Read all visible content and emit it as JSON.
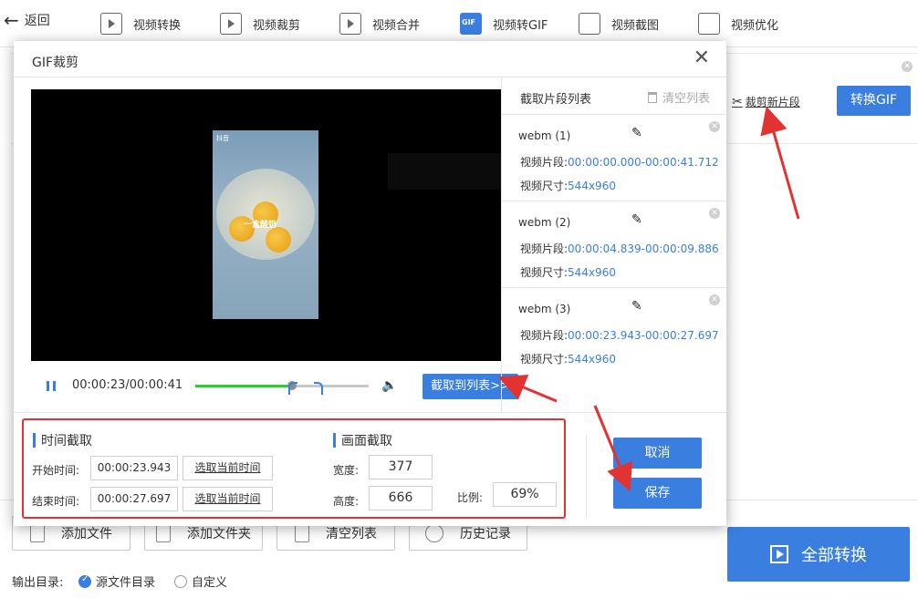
{
  "toolbar": {
    "back_label": "返回",
    "nav": [
      {
        "label": "视频转换",
        "icon": "video-convert-icon"
      },
      {
        "label": "视频裁剪",
        "icon": "video-crop-icon"
      },
      {
        "label": "视频合并",
        "icon": "video-merge-icon"
      },
      {
        "label": "视频转GIF",
        "icon": "gif-icon",
        "active": true
      },
      {
        "label": "视频截图",
        "icon": "screenshot-icon"
      },
      {
        "label": "视频优化",
        "icon": "optimize-icon"
      }
    ]
  },
  "background": {
    "cut_new_segment": "裁剪新片段",
    "convert_gif": "转换GIF",
    "bottom_buttons": [
      {
        "label": "添加文件",
        "icon": "add-file-icon"
      },
      {
        "label": "添加文件夹",
        "icon": "add-folder-icon"
      },
      {
        "label": "清空列表",
        "icon": "clear-list-icon"
      },
      {
        "label": "历史记录",
        "icon": "history-icon"
      }
    ],
    "output_dir_label": "输出目录:",
    "output_options": [
      {
        "label": "源文件目录",
        "selected": true
      },
      {
        "label": "自定义",
        "selected": false
      }
    ],
    "convert_all": "全部转换"
  },
  "dialog": {
    "title": "GIF裁剪",
    "video": {
      "caption": "一盒酸奶",
      "watermark": "抖音"
    },
    "player": {
      "time": "00:00:23/00:00:41",
      "progress": 0.56,
      "grab_button": "截取到列表>>"
    },
    "segments": {
      "header": "截取片段列表",
      "clear_label": "清空列表",
      "segment_label": "视频片段:",
      "size_label": "视频尺寸:",
      "items": [
        {
          "name": "webm (1)",
          "range": "00:00:00.000-00:00:41.712",
          "size": "544x960"
        },
        {
          "name": "webm (2)",
          "range": "00:00:04.839-00:00:09.886",
          "size": "544x960"
        },
        {
          "name": "webm (3)",
          "range": "00:00:23.943-00:00:27.697",
          "size": "544x960"
        }
      ]
    },
    "time_crop": {
      "title": "时间截取",
      "start_label": "开始时间:",
      "start_value": "00:00:23.943",
      "end_label": "结束时间:",
      "end_value": "00:00:27.697",
      "pick_current": "选取当前时间"
    },
    "frame_crop": {
      "title": "画面截取",
      "width_label": "宽度:",
      "width_value": "377",
      "height_label": "高度:",
      "height_value": "666",
      "ratio_label": "比例:",
      "ratio_value": "69%"
    },
    "cancel": "取消",
    "save": "保存"
  },
  "colors": {
    "accent": "#3a7ee0",
    "highlight_border": "#e23232",
    "progress_green": "#2ccc35"
  }
}
